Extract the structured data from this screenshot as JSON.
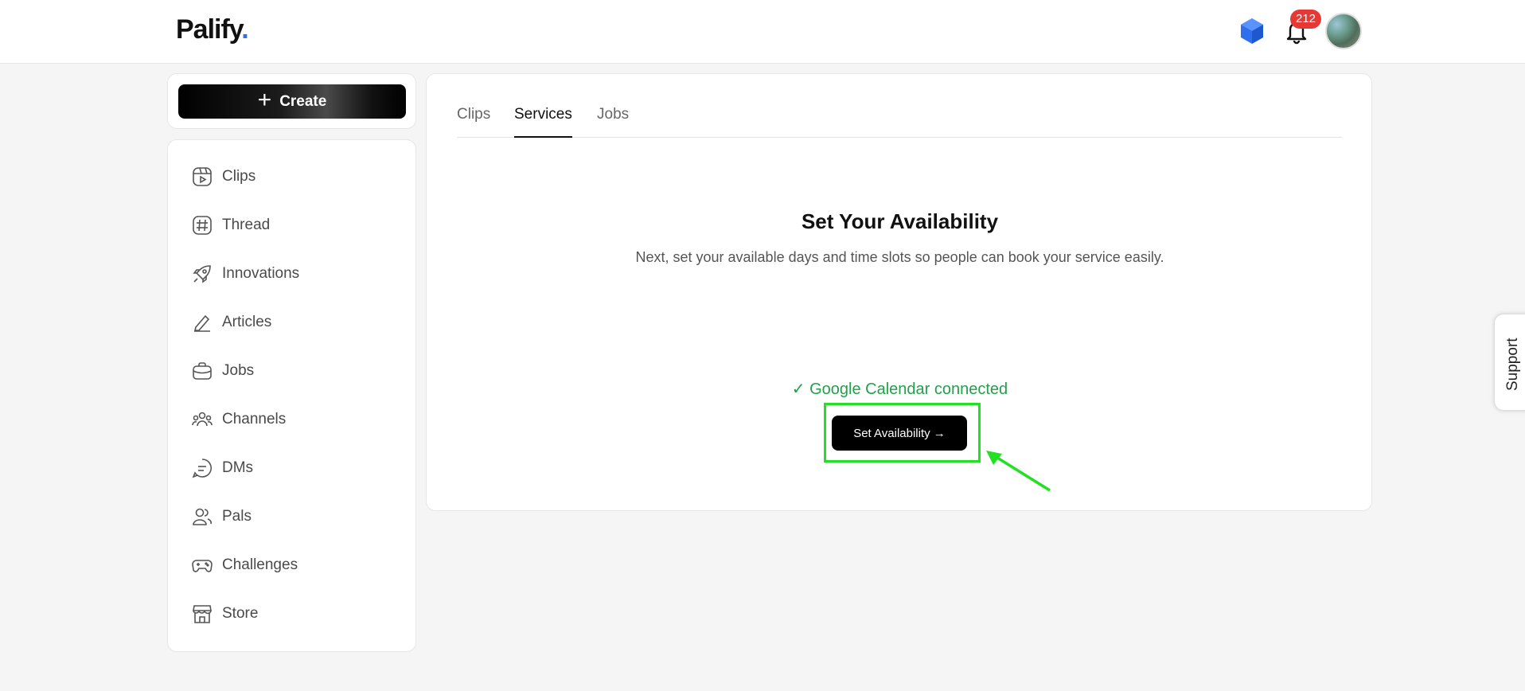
{
  "header": {
    "brand": "Palify",
    "brand_dot": ".",
    "notification_count": "212",
    "icons": [
      "hexagon-icon",
      "bell-icon"
    ]
  },
  "sidebar": {
    "create_label": "Create",
    "items": [
      {
        "label": "Clips",
        "icon": "clips-icon"
      },
      {
        "label": "Thread",
        "icon": "hash-icon"
      },
      {
        "label": "Innovations",
        "icon": "rocket-icon"
      },
      {
        "label": "Articles",
        "icon": "pencil-icon"
      },
      {
        "label": "Jobs",
        "icon": "briefcase-icon"
      },
      {
        "label": "Channels",
        "icon": "group-icon"
      },
      {
        "label": "DMs",
        "icon": "chat-icon"
      },
      {
        "label": "Pals",
        "icon": "users-icon"
      },
      {
        "label": "Challenges",
        "icon": "gamepad-icon"
      },
      {
        "label": "Store",
        "icon": "store-icon"
      }
    ]
  },
  "main": {
    "tabs": [
      {
        "label": "Clips",
        "active": false
      },
      {
        "label": "Services",
        "active": true
      },
      {
        "label": "Jobs",
        "active": false
      }
    ],
    "title": "Set Your Availability",
    "subtitle": "Next, set your available days and time slots so people can book your service easily.",
    "status": "✓ Google Calendar connected",
    "button_label": "Set Availability →"
  },
  "support_label": "Support",
  "colors": {
    "accent": "#2f6fed",
    "success": "#22a04a",
    "highlight": "#22e022",
    "badge": "#e53935"
  }
}
